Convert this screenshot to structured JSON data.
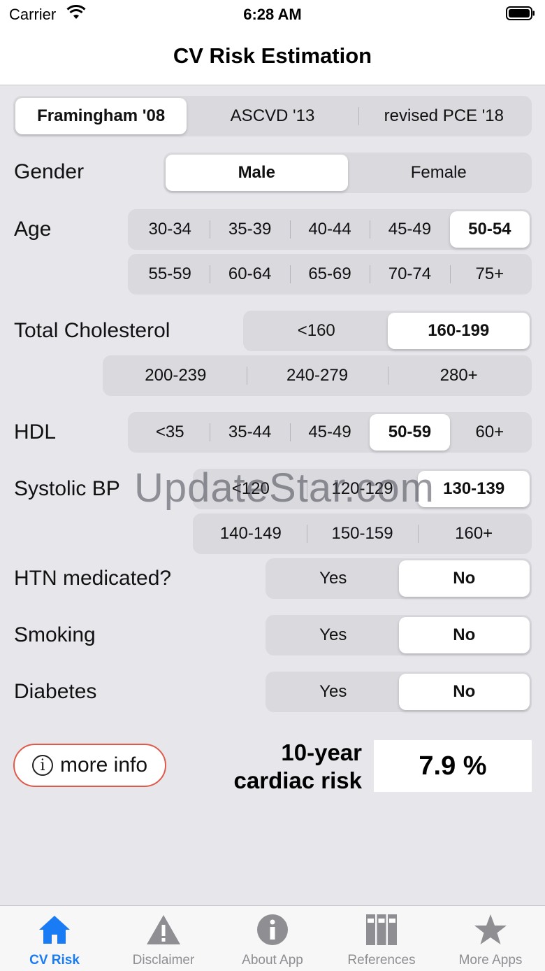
{
  "status_bar": {
    "carrier": "Carrier",
    "time": "6:28 AM"
  },
  "nav": {
    "title": "CV Risk Estimation"
  },
  "model_selector": {
    "options": [
      "Framingham '08",
      "ASCVD '13",
      "revised PCE '18"
    ],
    "selected": 0
  },
  "gender": {
    "label": "Gender",
    "options": [
      "Male",
      "Female"
    ],
    "selected": 0
  },
  "age": {
    "label": "Age",
    "row1": [
      "30-34",
      "35-39",
      "40-44",
      "45-49",
      "50-54"
    ],
    "row2": [
      "55-59",
      "60-64",
      "65-69",
      "70-74",
      "75+"
    ],
    "selected": "50-54"
  },
  "cholesterol": {
    "label": "Total Cholesterol",
    "row1": [
      "<160",
      "160-199"
    ],
    "row2": [
      "200-239",
      "240-279",
      "280+"
    ],
    "selected": "160-199"
  },
  "hdl": {
    "label": "HDL",
    "options": [
      "<35",
      "35-44",
      "45-49",
      "50-59",
      "60+"
    ],
    "selected": "50-59"
  },
  "systolic": {
    "label": "Systolic BP",
    "row1": [
      "<120",
      "120-129",
      "130-139"
    ],
    "row2": [
      "140-149",
      "150-159",
      "160+"
    ],
    "selected": "130-139"
  },
  "htn": {
    "label": "HTN medicated?",
    "options": [
      "Yes",
      "No"
    ],
    "selected": "No"
  },
  "smoking": {
    "label": "Smoking",
    "options": [
      "Yes",
      "No"
    ],
    "selected": "No"
  },
  "diabetes": {
    "label": "Diabetes",
    "options": [
      "Yes",
      "No"
    ],
    "selected": "No"
  },
  "watermark": "UpdateStar.com",
  "result": {
    "more_info": "more info",
    "risk_label_line1": "10-year",
    "risk_label_line2": "cardiac risk",
    "risk_value": "7.9 %"
  },
  "tabs": [
    {
      "label": "CV Risk",
      "icon": "house-icon",
      "active": true
    },
    {
      "label": "Disclaimer",
      "icon": "warning-icon",
      "active": false
    },
    {
      "label": "About App",
      "icon": "info-icon",
      "active": false
    },
    {
      "label": "References",
      "icon": "books-icon",
      "active": false
    },
    {
      "label": "More Apps",
      "icon": "star-icon",
      "active": false
    }
  ],
  "colors": {
    "accent": "#1a7cf5",
    "more_info_border": "#e05a4b",
    "background": "#e6e6eb"
  }
}
